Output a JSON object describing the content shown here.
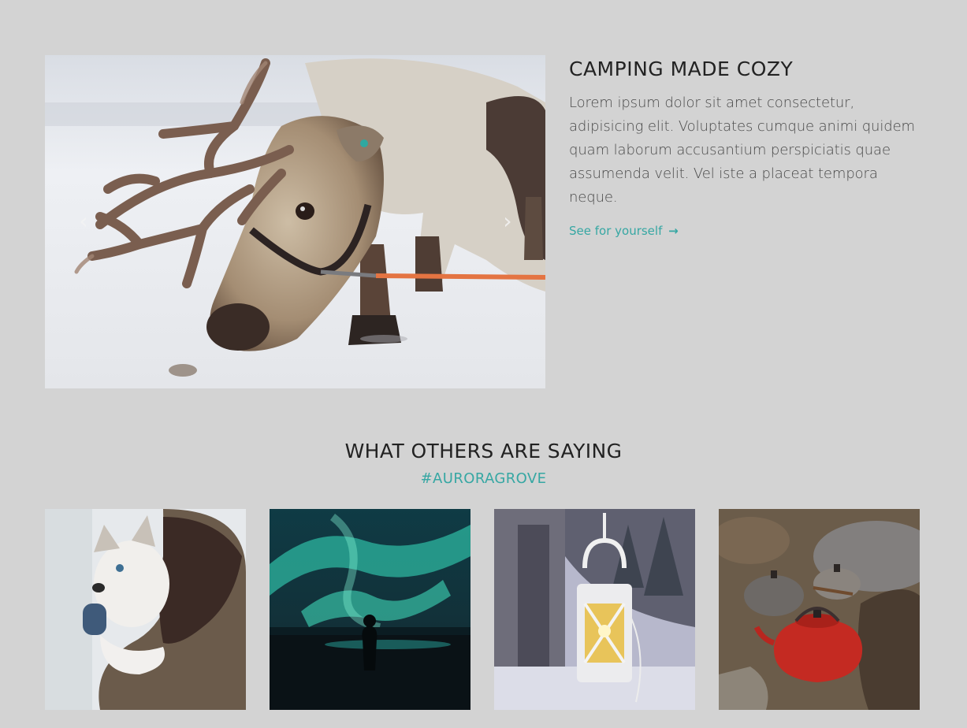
{
  "feature": {
    "title": "CAMPING MADE COZY",
    "body": "Lorem ipsum dolor sit amet consectetur, adipisicing elit. Voluptates cumque animi quidem quam laborum accusantium perspiciatis quae assumenda velit. Vel iste a placeat tempora neque.",
    "link_label": "See for yourself",
    "link_icon": "arrow-right-icon",
    "carousel_prev_icon": "chevron-left-icon",
    "carousel_next_icon": "chevron-right-icon",
    "carousel_slide": "reindeer-photo"
  },
  "testimonials": {
    "title": "WHAT OTHERS ARE SAYING",
    "hashtag": "#AURORAGROVE",
    "photos": [
      {
        "name": "husky-puppy-photo"
      },
      {
        "name": "aurora-borealis-photo"
      },
      {
        "name": "snowy-lantern-photo"
      },
      {
        "name": "campfire-kettles-photo"
      }
    ]
  },
  "colors": {
    "background": "#d3d3d3",
    "accent": "#36a7a3",
    "heading": "#222222",
    "body_text": "#4a4a4a"
  }
}
